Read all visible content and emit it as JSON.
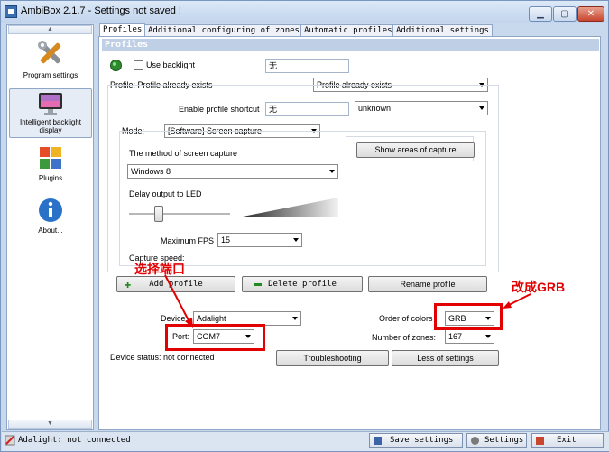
{
  "window": {
    "title": "AmbiBox 2.1.7  - Settings not saved !",
    "buttons": [
      "minimize",
      "maximize",
      "close"
    ]
  },
  "sidebar": {
    "items": [
      {
        "label": "Program settings",
        "icon": "tools-icon"
      },
      {
        "label": "Intelligent backlight display",
        "icon": "monitor-icon",
        "active": true
      },
      {
        "label": "Plugins",
        "icon": "puzzle-icon"
      },
      {
        "label": "About...",
        "icon": "info-icon"
      }
    ]
  },
  "tabs": [
    {
      "label": "Profiles",
      "active": true
    },
    {
      "label": "Additional configuring of zones"
    },
    {
      "label": "Automatic profiles"
    },
    {
      "label": "Additional settings"
    }
  ],
  "section_title": "Profiles",
  "backlight": {
    "label": "Use backlight",
    "checked": false,
    "value": "无"
  },
  "profile": {
    "label": "Profile: Profile already exists",
    "selected": "Profile already exists",
    "shortcut_label": "Enable profile shortcut",
    "shortcut_value": "无",
    "shortcut_mode": "unknown"
  },
  "mode": {
    "label": "Mode:",
    "selected": "[Software] Screen capture",
    "show_areas_button": "Show areas of capture",
    "capture_method_label": "The method of screen capture",
    "capture_method": "Windows 8",
    "delay_label": "Delay output to LED",
    "max_fps_label": "Maximum FPS",
    "max_fps": "15",
    "capture_speed_label": "Capture speed:"
  },
  "profile_buttons": {
    "add": "Add profile",
    "delete": "Delete profile",
    "rename": "Rename profile"
  },
  "device": {
    "device_label": "Device:",
    "device_value": "Adalight",
    "port_label": "Port:",
    "port_value": "COM7",
    "order_label": "Order of colors",
    "order_value": "GRB",
    "zones_label": "Number of zones:",
    "zones_value": "167",
    "status": "Device status: not connected",
    "troubleshooting": "Troubleshooting",
    "less_settings": "Less of settings"
  },
  "annotations": {
    "port_note": "选择端口",
    "order_note": "改成GRB"
  },
  "statusbar": {
    "text": "Adalight: not connected",
    "save": "Save settings",
    "settings": "Settings",
    "exit": "Exit"
  },
  "colors": {
    "annotation_red": "#e30000",
    "header_blue": "#bfcfe6",
    "window_frame": "#c8d9ee"
  }
}
